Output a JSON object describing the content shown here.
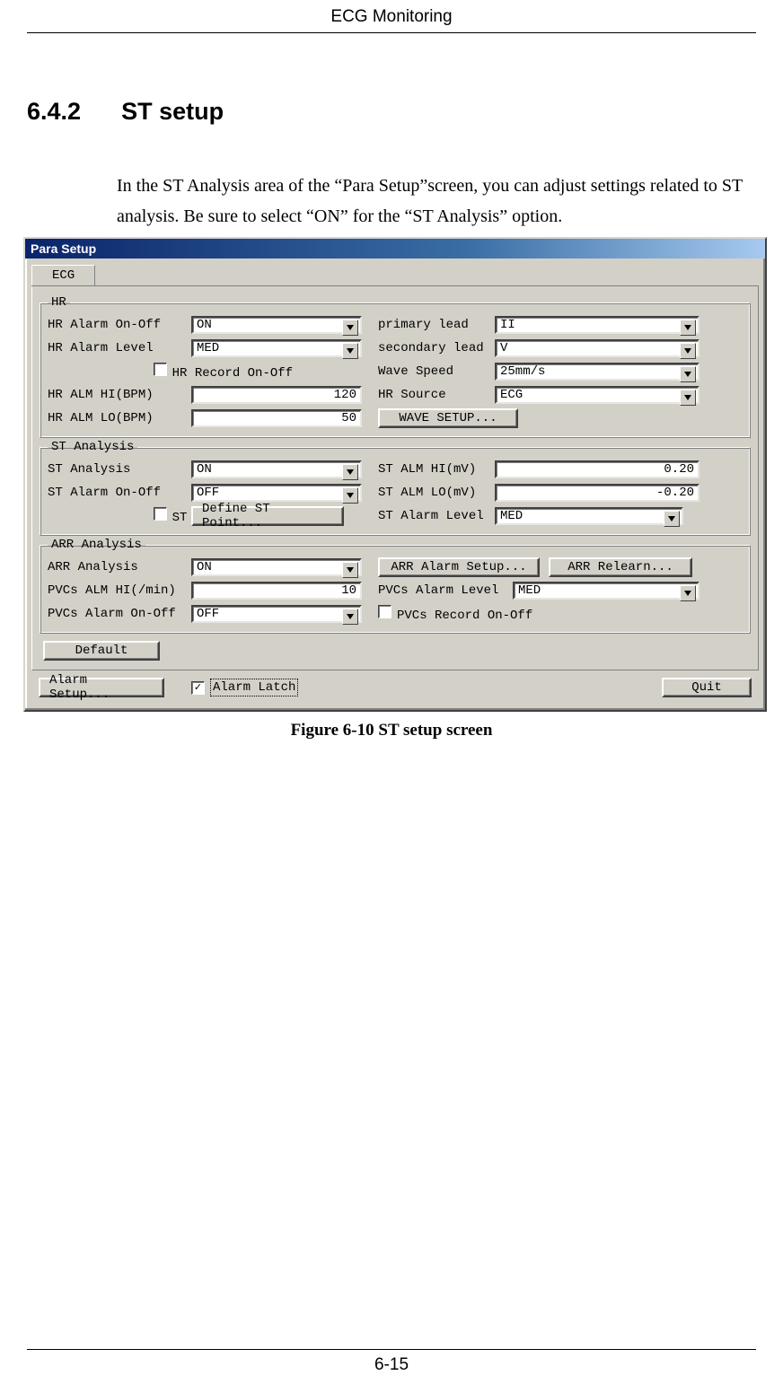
{
  "page": {
    "header": "ECG Monitoring",
    "section_number": "6.4.2",
    "section_title": "ST setup",
    "body": "In the ST Analysis area of the “Para Setup”screen, you can adjust settings related to ST analysis. Be sure to select “ON” for the “ST Analysis” option.",
    "caption": "Figure 6-10 ST setup screen",
    "footer": "6-15"
  },
  "window": {
    "title": "Para Setup",
    "tab": "ECG",
    "hr": {
      "legend": "HR",
      "alarm_on_off_label": "HR Alarm On-Off",
      "alarm_on_off": "ON",
      "alarm_level_label": "HR Alarm Level",
      "alarm_level": "MED",
      "record_label": "HR Record On-Off",
      "alm_hi_label": "HR ALM HI(BPM)",
      "alm_hi": "120",
      "alm_lo_label": "HR ALM LO(BPM)",
      "alm_lo": "50",
      "primary_lead_label": "primary lead",
      "primary_lead": "II",
      "secondary_lead_label": "secondary lead",
      "secondary_lead": "V",
      "wave_speed_label": "Wave Speed",
      "wave_speed": "25mm/s",
      "hr_source_label": "HR Source",
      "hr_source": "ECG",
      "wave_setup_btn": "WAVE SETUP..."
    },
    "st": {
      "legend": "ST Analysis",
      "analysis_label": "ST Analysis",
      "analysis": "ON",
      "alarm_on_off_label": "ST Alarm On-Off",
      "alarm_on_off": "OFF",
      "record_label": "ST Record On-Off",
      "define_btn": "Define ST Point...",
      "alm_hi_label": "ST ALM HI(mV)",
      "alm_hi": "0.20",
      "alm_lo_label": "ST ALM LO(mV)",
      "alm_lo": "-0.20",
      "alarm_level_label": "ST Alarm Level",
      "alarm_level": "MED"
    },
    "arr": {
      "legend": "ARR Analysis",
      "analysis_label": "ARR Analysis",
      "analysis": "ON",
      "pvcs_hi_label": "PVCs ALM HI(/min)",
      "pvcs_hi": "10",
      "pvcs_alarm_label": "PVCs Alarm On-Off",
      "pvcs_alarm": "OFF",
      "arr_alarm_setup_btn": "ARR Alarm Setup...",
      "arr_relearn_btn": "ARR Relearn...",
      "pvcs_level_label": "PVCs Alarm Level",
      "pvcs_level": "MED",
      "pvcs_record_label": "PVCs Record On-Off"
    },
    "default_btn": "Default",
    "alarm_setup_btn": "Alarm Setup...",
    "alarm_latch_label": "Alarm Latch",
    "quit_btn": "Quit"
  }
}
